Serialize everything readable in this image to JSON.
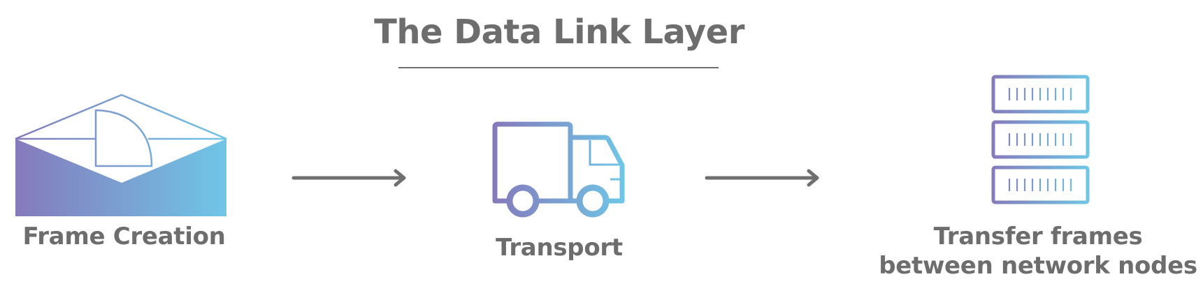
{
  "title": "The Data Link Layer",
  "steps": [
    {
      "label": "Frame Creation",
      "icon": "envelope-icon"
    },
    {
      "label": "Transport",
      "icon": "truck-icon"
    },
    {
      "label": "Transfer frames between network nodes",
      "icon": "server-stack-icon"
    }
  ],
  "colors": {
    "text": "#6d6d6d",
    "arrow": "#6f6f6f",
    "gradient_start": "#857abb",
    "gradient_end": "#6fc6e6"
  }
}
